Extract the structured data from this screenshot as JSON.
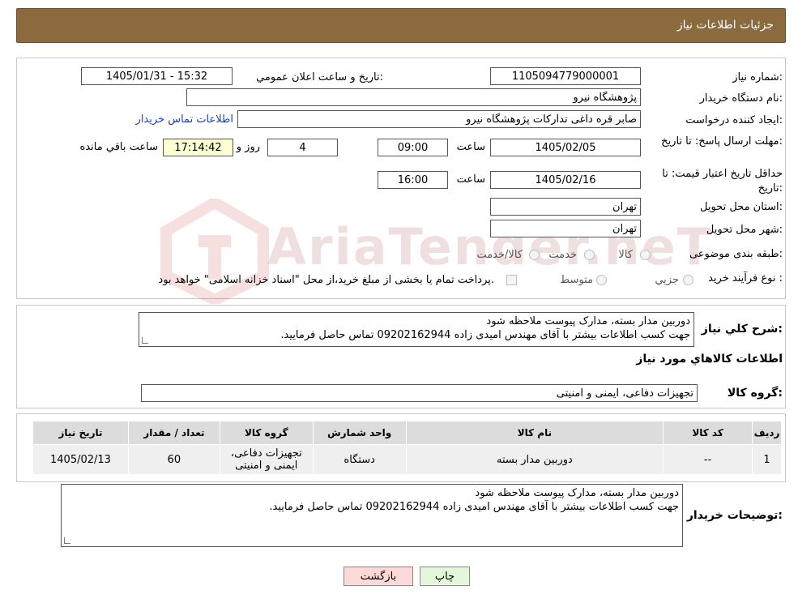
{
  "header": {
    "title": "جزئیات اطلاعات نیاز"
  },
  "watermark": {
    "text": "AriaTender.neT"
  },
  "form": {
    "need_number": {
      "label": "شماره نیاز:",
      "value": "1105094779000001"
    },
    "announce": {
      "label": "تاریخ و ساعت اعلان عمومي:",
      "value": "1405/01/31 - 15:32"
    },
    "buyer_org": {
      "label": "نام دستگاه خريدار:",
      "value": "پژوهشگاه نیرو"
    },
    "requester": {
      "label": "ايجاد کننده درخواست:",
      "value": "صابر قره داغی تدارکات پژوهشگاه نیرو",
      "contact_link": "اطلاعات تماس خريدار"
    },
    "deadline": {
      "label": "مهلت ارسال پاسخ: تا تاريخ:",
      "date": "1405/02/05",
      "time_label": "ساعت",
      "time": "09:00",
      "days": "4",
      "days_label": "روز و",
      "remaining": "17:14:42",
      "remaining_label": "ساعت باقي مانده"
    },
    "validity": {
      "label": "حداقل تاريخ اعتبار قيمت: تا تاريخ:",
      "date": "1405/02/16",
      "time_label": "ساعت",
      "time": "16:00"
    },
    "province": {
      "label": "استان محل تحويل:",
      "value": "تهران"
    },
    "city": {
      "label": "شهر محل تحويل:",
      "value": "تهران"
    },
    "category": {
      "label": "طبقه بندی موضوعی:",
      "options": [
        "کالا",
        "خدمت",
        "کالا/خدمت"
      ]
    },
    "process": {
      "label": "نوع فرآيند خريد :",
      "options": [
        "جزيي",
        "متوسط"
      ],
      "note": "پرداخت تمام يا بخشی از مبلغ خريد،از محل \"اسناد خزانه اسلامی\" خواهد بود."
    }
  },
  "description": {
    "label": "شرح کلي نياز:",
    "lines": [
      "دوربین مدار بسته، مدارک پیوست ملاحظه شود",
      "جهت کسب اطلاعات بیشتر با آقای مهندس امیدی زاده 09202162944 تماس حاصل فرمایید."
    ]
  },
  "goods_section": {
    "title": "اطلاعات کالاهاي مورد نياز"
  },
  "goods_group": {
    "label": "گروه کالا:",
    "value": "تجهیزات دفاعی، ایمنی و امنیتی"
  },
  "table": {
    "headers": [
      "رديف",
      "کد کالا",
      "نام کالا",
      "واحد شمارش",
      "گروه کالا",
      "تعداد / مقدار",
      "تاريخ نياز"
    ],
    "rows": [
      [
        "1",
        "--",
        "دوربین مدار بسته",
        "دستگاه",
        "تجهیزات دفاعی، ایمنی و امنیتی",
        "60",
        "1405/02/13"
      ]
    ]
  },
  "buyer_notes": {
    "label": "توضيحات خريدار:",
    "lines": [
      "دوربین مدار بسته، مدارک پیوست ملاحظه شود",
      "جهت کسب اطلاعات بیشتر با آقای مهندس امیدی زاده 09202162944 تماس حاصل فرمایید."
    ]
  },
  "buttons": {
    "print": "چاپ",
    "back": "بازگشت"
  }
}
